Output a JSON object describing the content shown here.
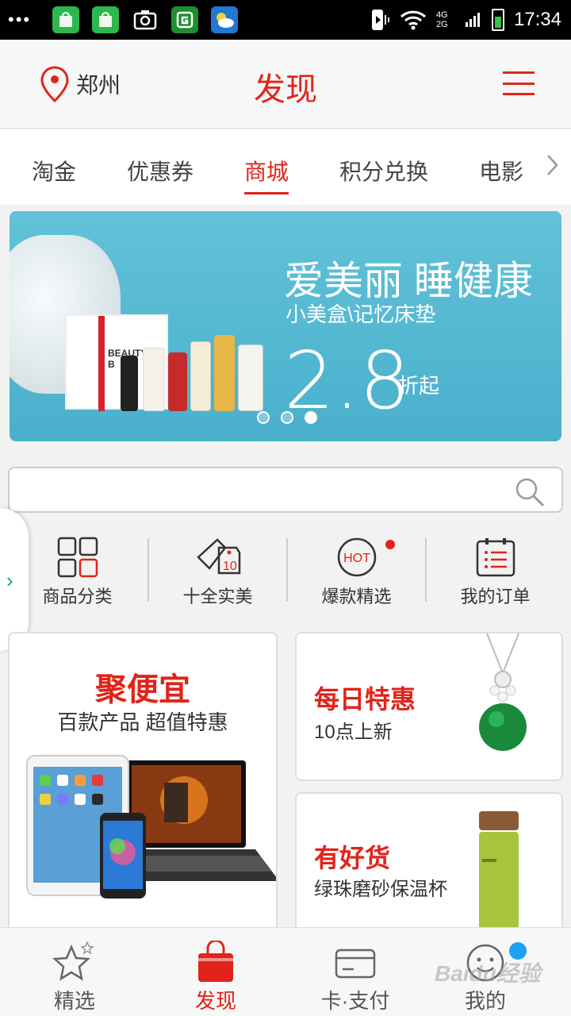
{
  "status_bar": {
    "dots": "•••",
    "network": "4G 2G",
    "time": "17:34"
  },
  "header": {
    "location": "郑州",
    "title": "发现",
    "accent_color": "#e2231a"
  },
  "tabs": [
    {
      "label": "淘金",
      "active": false
    },
    {
      "label": "优惠券",
      "active": false
    },
    {
      "label": "商城",
      "active": true
    },
    {
      "label": "积分兑换",
      "active": false
    },
    {
      "label": "电影",
      "active": false
    }
  ],
  "banner": {
    "title": "爱美丽 睡健康",
    "subtitle": "小美盒\\记忆床垫",
    "price": "2.8",
    "price_suffix": "折起",
    "box_text": "BEAUTY B",
    "slide_index": 3,
    "slide_count": 3
  },
  "search": {
    "value": "",
    "placeholder": ""
  },
  "quick_nav": [
    {
      "label": "商品分类",
      "icon": "grid-icon"
    },
    {
      "label": "十全实美",
      "icon": "tag-10-icon"
    },
    {
      "label": "爆款精选",
      "icon": "hot-icon",
      "badge_text": "HOT"
    },
    {
      "label": "我的订单",
      "icon": "order-list-icon"
    }
  ],
  "cards": {
    "big": {
      "title": "聚便宜",
      "subtitle": "百款产品 超值特惠"
    },
    "small": [
      {
        "title": "每日特惠",
        "subtitle": "10点上新"
      },
      {
        "title": "有好货",
        "subtitle": "绿珠磨砂保温杯"
      }
    ]
  },
  "bottom_nav": [
    {
      "label": "精选",
      "icon": "star-icon",
      "active": false
    },
    {
      "label": "发现",
      "icon": "shopping-bag-icon",
      "active": true
    },
    {
      "label": "卡·支付",
      "icon": "card-icon",
      "active": false
    },
    {
      "label": "我的",
      "icon": "smiley-icon",
      "active": false
    }
  ],
  "watermark": "Baidu经验"
}
